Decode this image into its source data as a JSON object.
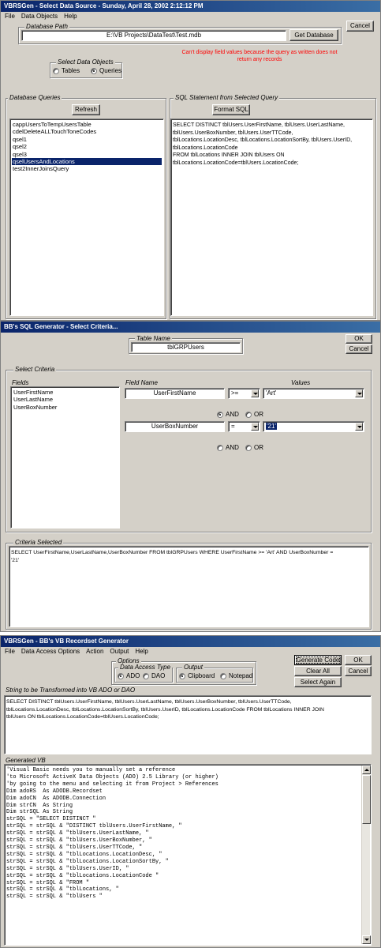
{
  "win1": {
    "title": "VBRSGen  -  Select Data Source  -  Sunday, April 28, 2002  2:12:12 PM",
    "menu": [
      "File",
      "Data Objects",
      "Help"
    ],
    "db_path_label": "Database Path",
    "db_path_value": "E:\\VB Projects\\DataTest\\Test.mdb",
    "get_database_label": "Get Database",
    "cancel_label": "Cancel",
    "error_message": "Can't display field values because the query as written does not return any records",
    "select_objects_label": "Select Data Objects",
    "radio_tables": "Tables",
    "radio_queries": "Queries",
    "queries_group_label": "Database Queries",
    "refresh_label": "Refresh",
    "queries": [
      "cappUsersToTempUsersTable",
      "cdelDeleteALLTouchToneCodes",
      "qsel1",
      "qsel2",
      "qsel3",
      "qselUsersAndLocations",
      "test2InnerJoinsQuery"
    ],
    "selected_query_index": 5,
    "sql_group_label": "SQL Statement from Selected Query",
    "format_sql_label": "Format SQL",
    "sql_lines": [
      "SELECT DISTINCT tblUsers.UserFirstName, tblUsers.UserLastName,",
      "tblUsers.UserBoxNumber, tblUsers.UserTTCode,",
      "tblLocations.LocationDesc, tblLocations.LocationSortBy, tblUsers.UserID,",
      "tblLocations.LocationCode",
      "FROM tblLocations INNER JOIN tblUsers ON",
      "tblLocations.LocationCode=tblUsers.LocationCode;"
    ]
  },
  "win2": {
    "title": "BB's SQL Generator - Select Criteria...",
    "table_name_label": "Table Name",
    "table_name_value": "tblGRPUsers",
    "ok_label": "OK",
    "cancel_label": "Cancel",
    "criteria_group_label": "Select Criteria",
    "fields_label": "Fields",
    "field_name_label": "Field Name",
    "values_label": "Values",
    "fields": [
      "UserFirstName",
      "UserLastName",
      "UserBoxNumber"
    ],
    "row1": {
      "field": "UserFirstName",
      "operator": ">=",
      "value": "'Art'"
    },
    "row2": {
      "field": "UserBoxNumber",
      "operator": "=",
      "value": "'21'"
    },
    "and_label": "AND",
    "or_label": "OR",
    "selected_group_label": "Criteria Selected",
    "criteria_lines": [
      "SELECT UserFirstName,UserLastName,UserBoxNumber FROM tblGRPUsers  WHERE UserFirstName >= 'Art' AND UserBoxNumber =",
      "'21'"
    ]
  },
  "win3": {
    "title": "VBRSGen - BB's VB Recordset Generator",
    "menu": [
      "File",
      "Data Access Options",
      "Action",
      "Output",
      "Help"
    ],
    "options_label": "Options",
    "data_access_label": "Data Access Type",
    "radio_ado": "ADO",
    "radio_dao": "DAO",
    "output_label": "Output",
    "radio_clipboard": "Clipboard",
    "radio_notepad": "Notepad",
    "generate_label": "Generate Code",
    "ok_label": "OK",
    "clear_label": "Clear All",
    "cancel_label": "Cancel",
    "select_again_label": "Select Again",
    "string_label": "String to be Transformed into VB ADO or DAO",
    "string_lines": [
      "SELECT DISTINCT tblUsers.UserFirstName, tblUsers.UserLastName, tblUsers.UserBoxNumber, tblUsers.UserTTCode,",
      "tblLocations.LocationDesc, tblLocations.LocationSortBy, tblUsers.UserID, tblLocations.LocationCode FROM tblLocations INNER JOIN",
      "tblUsers ON tblLocations.LocationCode=tblUsers.LocationCode;"
    ],
    "generated_label": "Generated VB",
    "code_lines": [
      "'Visual Basic needs you to manually set a reference",
      "'to Microsoft ActiveX Data Objects (ADO) 2.5 Library (or higher)",
      "'by going to the menu and selecting it from Project > References",
      "",
      "Dim adoRS  As ADODB.Recordset",
      "Dim adoCN  As ADODB.Connection",
      "Dim strCN  As String",
      "Dim strSQL As String",
      "",
      "strSQL = \"SELECT DISTINCT \"",
      "strSQL = strSQL & \"DISTINCT tblUsers.UserFirstName, \"",
      "strSQL = strSQL & \"tblUsers.UserLastName, \"",
      "strSQL = strSQL & \"tblUsers.UserBoxNumber, \"",
      "strSQL = strSQL & \"tblUsers.UserTTCode, \"",
      "strSQL = strSQL & \"tblLocations.LocationDesc, \"",
      "strSQL = strSQL & \"tblLocations.LocationSortBy, \"",
      "strSQL = strSQL & \"tblUsers.UserID, \"",
      "strSQL = strSQL & \"tblLocations.LocationCode \"",
      "strSQL = strSQL & \"FROM \"",
      "strSQL = strSQL & \"tblLocations, \"",
      "strSQL = strSQL & \"tblUsers \""
    ]
  }
}
